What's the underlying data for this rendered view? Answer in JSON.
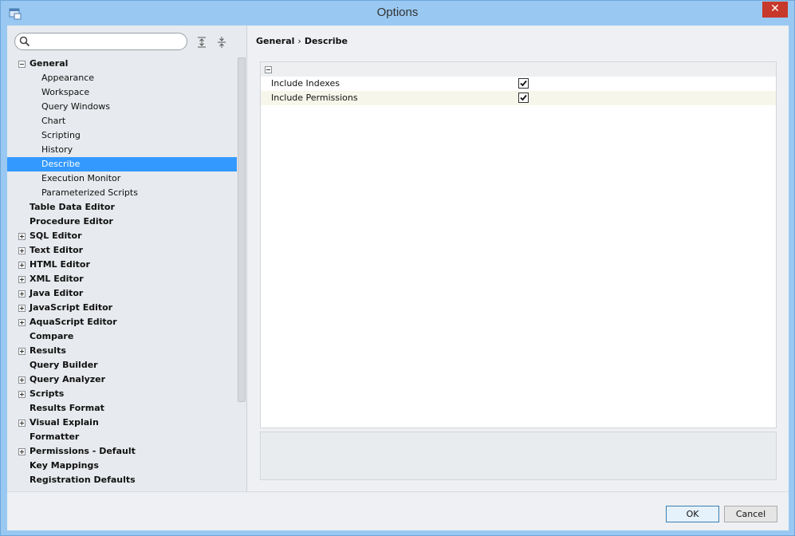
{
  "window": {
    "title": "Options",
    "close_glyph": "✕"
  },
  "search": {
    "placeholder": "",
    "value": ""
  },
  "tree": {
    "items": [
      {
        "label": "General",
        "level": 0,
        "bold": true,
        "toggle": "minus"
      },
      {
        "label": "Appearance",
        "level": 1,
        "bold": false,
        "toggle": ""
      },
      {
        "label": "Workspace",
        "level": 1,
        "bold": false,
        "toggle": ""
      },
      {
        "label": "Query Windows",
        "level": 1,
        "bold": false,
        "toggle": ""
      },
      {
        "label": "Chart",
        "level": 1,
        "bold": false,
        "toggle": ""
      },
      {
        "label": "Scripting",
        "level": 1,
        "bold": false,
        "toggle": ""
      },
      {
        "label": "History",
        "level": 1,
        "bold": false,
        "toggle": ""
      },
      {
        "label": "Describe",
        "level": 1,
        "bold": false,
        "toggle": "",
        "selected": true
      },
      {
        "label": "Execution Monitor",
        "level": 1,
        "bold": false,
        "toggle": ""
      },
      {
        "label": "Parameterized Scripts",
        "level": 1,
        "bold": false,
        "toggle": ""
      },
      {
        "label": "Table Data Editor",
        "level": 0,
        "bold": true,
        "toggle": ""
      },
      {
        "label": "Procedure Editor",
        "level": 0,
        "bold": true,
        "toggle": ""
      },
      {
        "label": "SQL Editor",
        "level": 0,
        "bold": true,
        "toggle": "plus"
      },
      {
        "label": "Text Editor",
        "level": 0,
        "bold": true,
        "toggle": "plus"
      },
      {
        "label": "HTML Editor",
        "level": 0,
        "bold": true,
        "toggle": "plus"
      },
      {
        "label": "XML Editor",
        "level": 0,
        "bold": true,
        "toggle": "plus"
      },
      {
        "label": "Java Editor",
        "level": 0,
        "bold": true,
        "toggle": "plus"
      },
      {
        "label": "JavaScript Editor",
        "level": 0,
        "bold": true,
        "toggle": "plus"
      },
      {
        "label": "AquaScript Editor",
        "level": 0,
        "bold": true,
        "toggle": "plus"
      },
      {
        "label": "Compare",
        "level": 0,
        "bold": true,
        "toggle": ""
      },
      {
        "label": "Results",
        "level": 0,
        "bold": true,
        "toggle": "plus"
      },
      {
        "label": "Query Builder",
        "level": 0,
        "bold": true,
        "toggle": ""
      },
      {
        "label": "Query Analyzer",
        "level": 0,
        "bold": true,
        "toggle": "plus"
      },
      {
        "label": "Scripts",
        "level": 0,
        "bold": true,
        "toggle": "plus"
      },
      {
        "label": "Results Format",
        "level": 0,
        "bold": true,
        "toggle": ""
      },
      {
        "label": "Visual Explain",
        "level": 0,
        "bold": true,
        "toggle": "plus"
      },
      {
        "label": "Formatter",
        "level": 0,
        "bold": true,
        "toggle": ""
      },
      {
        "label": "Permissions - Default",
        "level": 0,
        "bold": true,
        "toggle": "plus"
      },
      {
        "label": "Key Mappings",
        "level": 0,
        "bold": true,
        "toggle": ""
      },
      {
        "label": "Registration Defaults",
        "level": 0,
        "bold": true,
        "toggle": ""
      }
    ]
  },
  "breadcrumb": {
    "parent": "General",
    "separator": "›",
    "current": "Describe"
  },
  "properties": [
    {
      "label": "Include Indexes",
      "checked": true
    },
    {
      "label": "Include Permissions",
      "checked": true
    }
  ],
  "footer": {
    "ok_label": "OK",
    "cancel_label": "Cancel"
  },
  "colors": {
    "titlebar": "#99c9f2",
    "selection": "#3399ff",
    "close": "#c7392b"
  }
}
